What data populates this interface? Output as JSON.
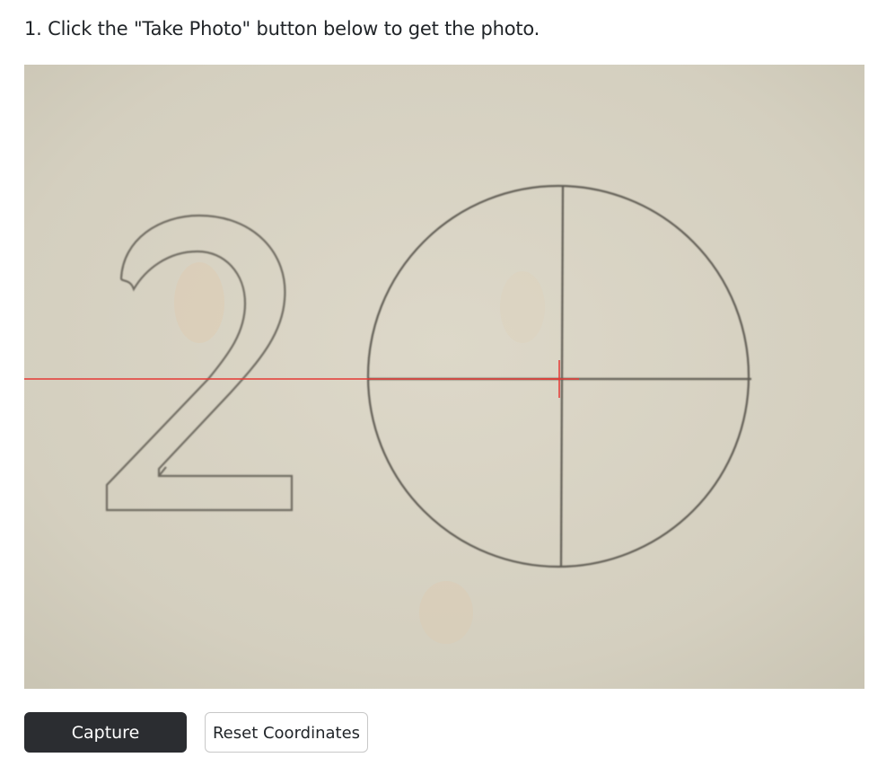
{
  "instruction": {
    "text": "1. Click the \"Take Photo\" button below to get the photo."
  },
  "photo": {
    "icon": "captured-photo-image",
    "marker_color": "#e53935"
  },
  "buttons": {
    "capture_label": "Capture",
    "reset_label": "Reset Coordinates"
  },
  "colors": {
    "capture_bg": "#2b2d31",
    "marker": "#e53935"
  }
}
